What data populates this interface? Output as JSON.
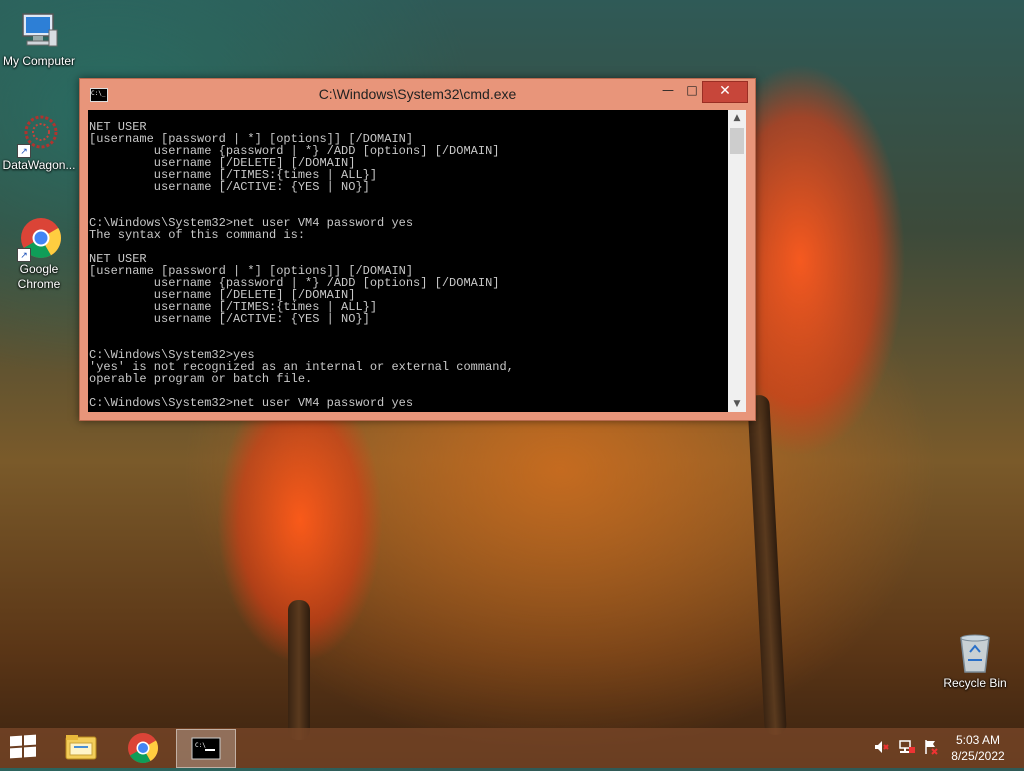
{
  "desktop": {
    "icons": [
      {
        "label": "My Computer"
      },
      {
        "label": "DataWagon..."
      },
      {
        "label": "Google Chrome"
      },
      {
        "label": "Recycle Bin"
      }
    ]
  },
  "window": {
    "title": "C:\\Windows\\System32\\cmd.exe",
    "minimize_glyph": "—",
    "maximize_glyph": "□",
    "close_glyph": "✕",
    "console_text": "NET USER\n[username [password | *] [options]] [/DOMAIN]\n         username {password | *} /ADD [options] [/DOMAIN]\n         username [/DELETE] [/DOMAIN]\n         username [/TIMES:{times | ALL}]\n         username [/ACTIVE: {YES | NO}]\n\n\nC:\\Windows\\System32>net user VM4 password yes\nThe syntax of this command is:\n\nNET USER\n[username [password | *] [options]] [/DOMAIN]\n         username {password | *} /ADD [options] [/DOMAIN]\n         username [/DELETE] [/DOMAIN]\n         username [/TIMES:{times | ALL}]\n         username [/ACTIVE: {YES | NO}]\n\n\nC:\\Windows\\System32>yes\n'yes' is not recognized as an internal or external command,\noperable program or batch file.\n\nC:\\Windows\\System32>net user VM4 password yes"
  },
  "taskbar": {
    "items": [
      {
        "icon": "file-explorer-icon"
      },
      {
        "icon": "chrome-icon"
      },
      {
        "icon": "cmd-icon",
        "active": true
      }
    ],
    "tray_icons": [
      "volume-muted-icon",
      "network-icon",
      "action-center-icon"
    ],
    "clock": {
      "time": "5:03 AM",
      "date": "8/25/2022"
    }
  },
  "colors": {
    "titlebar": "#e8957a",
    "close_button": "#c7463a",
    "console_bg": "#000000",
    "console_text": "#c8c8c8"
  }
}
